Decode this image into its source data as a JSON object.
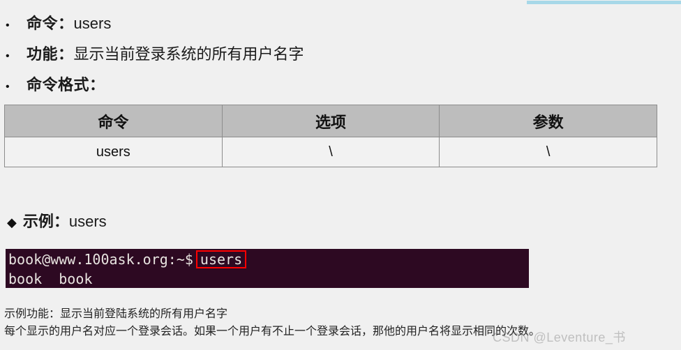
{
  "page": {
    "background_color": "#f0f0f0",
    "accent_bar_color": "#a7d8e8"
  },
  "bullets": [
    {
      "marker": "•",
      "label": "命令：",
      "value": "users"
    },
    {
      "marker": "•",
      "label": "功能：",
      "value": "显示当前登录系统的所有用户名字"
    },
    {
      "marker": "•",
      "label": "命令格式：",
      "value": ""
    }
  ],
  "table": {
    "headers": [
      "命令",
      "选项",
      "参数"
    ],
    "rows": [
      [
        "users",
        "\\",
        "\\"
      ]
    ],
    "header_bg": "#bdbdbd",
    "row_bg": "#f2f2f2",
    "border_color": "#8c8c8c"
  },
  "example": {
    "marker": "◆",
    "label": "示例：",
    "value": "users"
  },
  "terminal": {
    "background_color": "#2d0922",
    "text_color": "#e8e4e0",
    "highlight_color": "#ff0000",
    "prompt": "book@www.100ask.org:~$",
    "command": "users",
    "output": "book  book"
  },
  "footer": {
    "lines": [
      "示例功能：显示当前登陆系统的所有用户名字",
      "每个显示的用户名对应一个登录会话。如果一个用户有不止一个登录会话，那他的用户名将显示相同的次数。"
    ]
  },
  "watermark": {
    "text": "CSDN @Leventure_书"
  }
}
